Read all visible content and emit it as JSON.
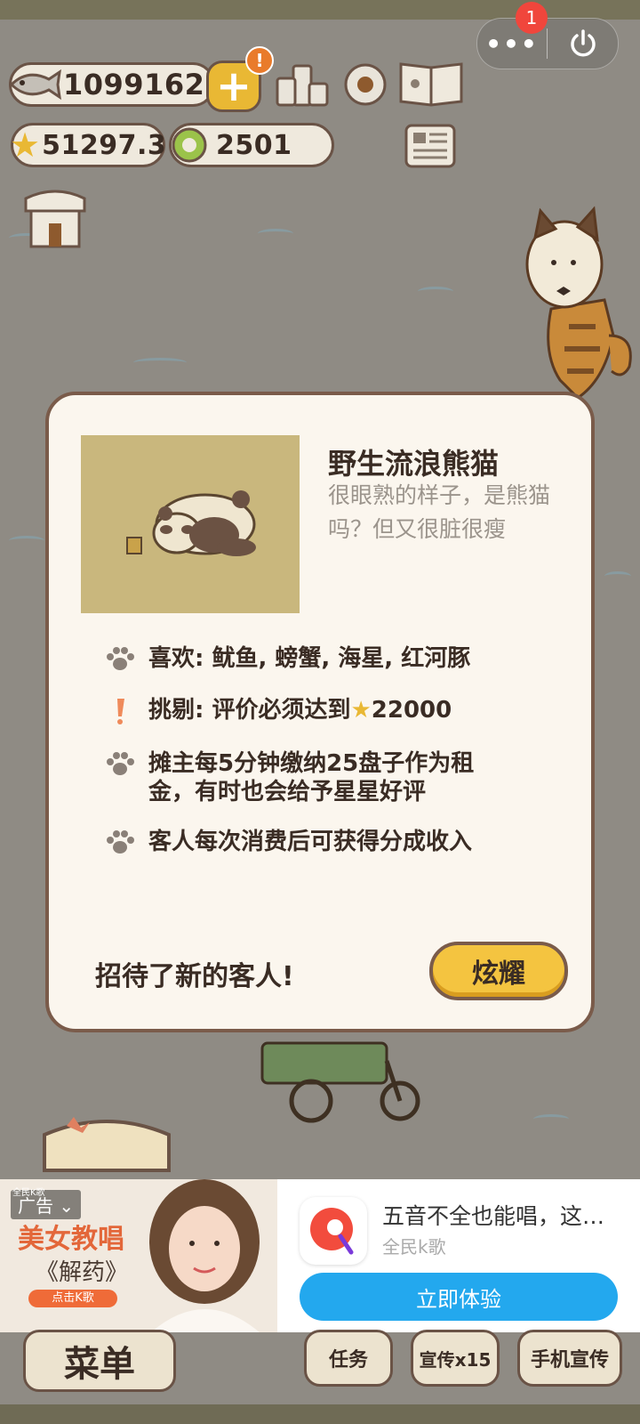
{
  "hud": {
    "fish_count": "1099162",
    "alert_mark": "!",
    "plus_label": "+",
    "star_rating": "51297.3",
    "token_count": "2501"
  },
  "capsule": {
    "more": "•••",
    "notification_count": "1"
  },
  "modal": {
    "name": "野生流浪熊猫",
    "description": "很眼熟的样子，是熊猫吗？但又很脏很瘦",
    "traits": [
      {
        "icon": "paw-icon",
        "text": "喜欢: 鱿鱼, 螃蟹, 海星, 红河豚"
      },
      {
        "icon": "exclamation-icon",
        "text_prefix": "挑剔: 评价必须达到",
        "value": "22000"
      },
      {
        "icon": "paw-icon",
        "text": "摊主每5分钟缴纳25盘子作为租金，有时也会给予星星好评"
      },
      {
        "icon": "paw-icon",
        "text": "客人每次消费后可获得分成收入"
      }
    ],
    "footer": "招待了新的客人!",
    "show_button": "炫耀"
  },
  "ad": {
    "tag": "广告",
    "left_brand": "全民K歌",
    "headline": "美女教唱",
    "song": "《解药》",
    "chip": "点击K歌",
    "title": "五音不全也能唱，这…",
    "brand": "全民k歌",
    "cta": "立即体验"
  },
  "bottom_nav": {
    "menu": "菜单",
    "tasks": "任务",
    "promote": "宣传x15",
    "phone_promote": "手机宣传"
  },
  "colors": {
    "accent": "#f4c440",
    "border": "#7a5b4a",
    "modal_bg": "#fbf6ee",
    "ad_cta": "#23a8ee"
  }
}
